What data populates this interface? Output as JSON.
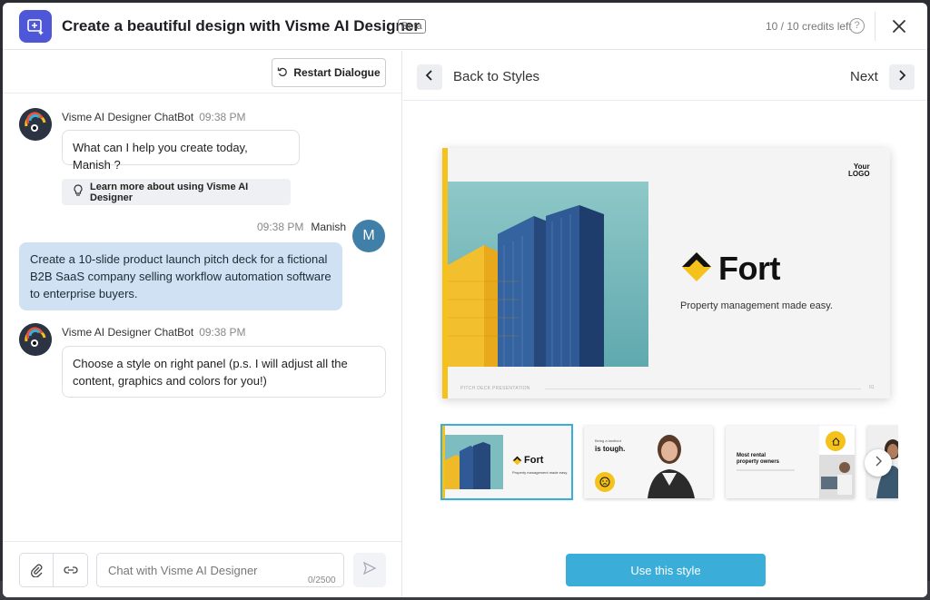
{
  "header": {
    "title": "Create a beautiful design with Visme AI Designer",
    "badge": "Beta",
    "credits": "10 / 10 credits left",
    "help_glyph": "?",
    "icons": {
      "app": "sparkle-screen-icon",
      "help": "help-icon",
      "close": "close-icon"
    }
  },
  "chat": {
    "restart_label": "Restart Dialogue",
    "messages": [
      {
        "sender": "Visme AI Designer ChatBot",
        "time": "09:38 PM",
        "text": "What can I help you create today, Manish ?"
      },
      {
        "sender": "Manish",
        "time": "09:38 PM",
        "avatar_letter": "M",
        "text": "Create a 10-slide product launch pitch deck for a fictional B2B SaaS company selling workflow automation software to enterprise buyers."
      },
      {
        "sender": "Visme AI Designer ChatBot",
        "time": "09:38 PM",
        "text": "Choose a style on right panel (p.s. I will adjust all the content, graphics and colors for you!)"
      }
    ],
    "learn_more_label": "Learn more about using Visme AI Designer",
    "input_placeholder": "Chat with Visme AI Designer",
    "char_counter": "0/2500"
  },
  "styles": {
    "back_label": "Back to Styles",
    "next_label": "Next",
    "preview": {
      "logo_line1": "Your",
      "logo_line2": "LOGO",
      "brand": "Fort",
      "tagline": "Property management made easy.",
      "footer": "PITCH DECK PRESENTATION",
      "page": "01"
    },
    "thumbnails": [
      {
        "brand": "Fort",
        "tagline": "Property management made easy."
      },
      {
        "small": "Being a landlord",
        "headline": "is tough."
      },
      {
        "headline_line1": "Most rental",
        "headline_line2": "property owners"
      },
      {}
    ],
    "use_label": "Use this style"
  },
  "colors": {
    "accent_blue": "#3aaed8",
    "brand_purple": "#4f57d9",
    "fort_yellow": "#f4c21b",
    "user_bubble": "#cfe1f3"
  }
}
